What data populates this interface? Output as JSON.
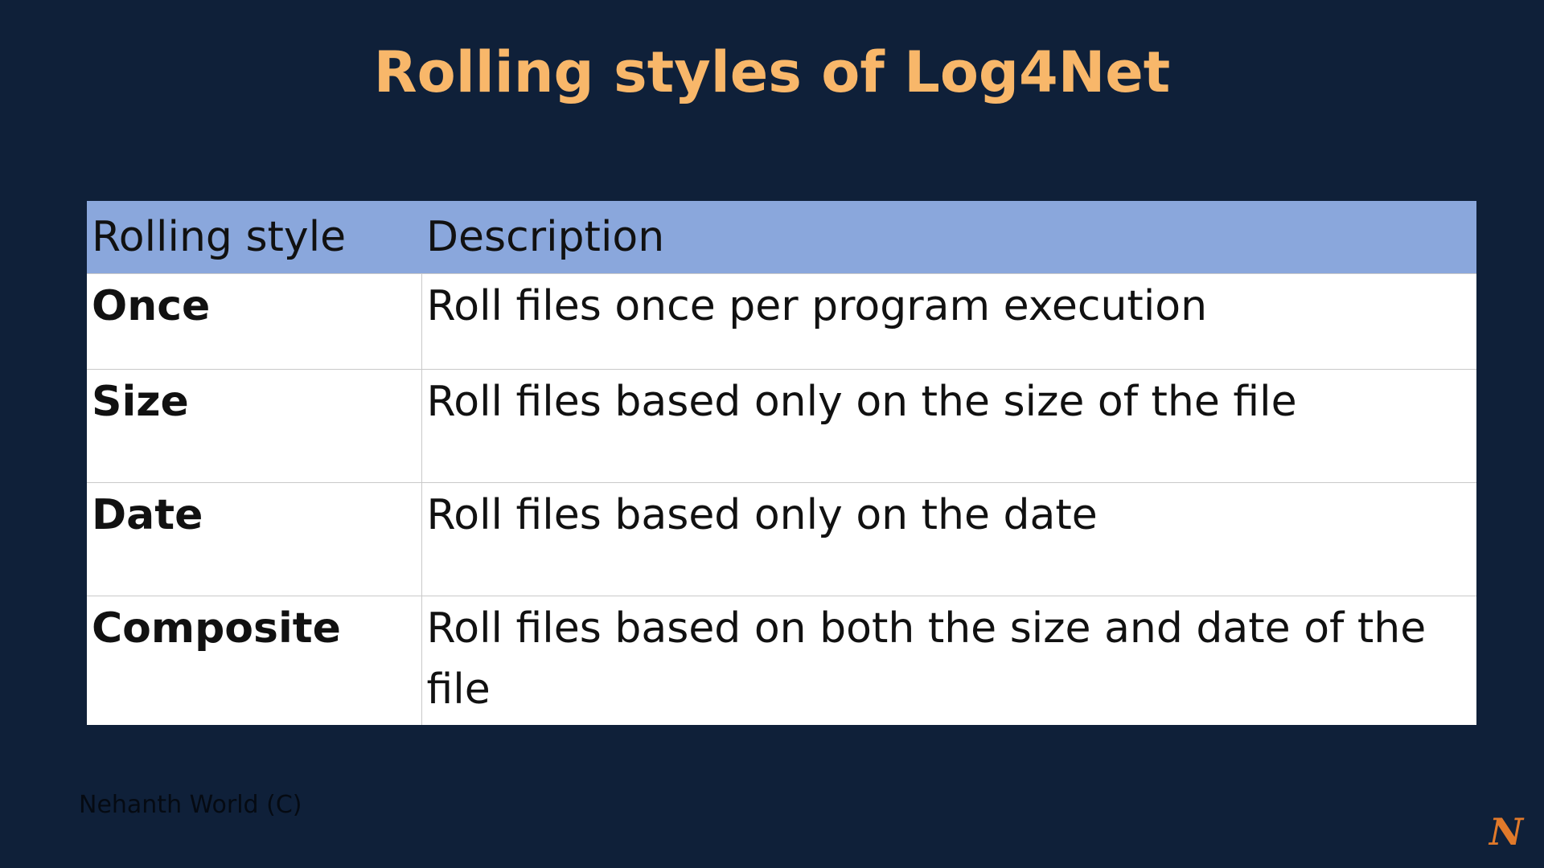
{
  "slide": {
    "title": "Rolling styles of Log4Net"
  },
  "table": {
    "headers": [
      "Rolling style",
      "Description"
    ],
    "rows": [
      {
        "style": "Once",
        "description": "Roll files once per program execution"
      },
      {
        "style": "Size",
        "description": "Roll files based only on the size of the file"
      },
      {
        "style": "Date",
        "description": "Roll files based only on the date"
      },
      {
        "style": "Composite",
        "description": "Roll files based on both the size and date of the file"
      }
    ]
  },
  "footer": {
    "copyright": "Nehanth World (C)",
    "logo_letter": "N"
  },
  "colors": {
    "background": "#0f2039",
    "title": "#f8b76a",
    "header_row": "#8aa7dc",
    "logo": "#e0792a"
  }
}
